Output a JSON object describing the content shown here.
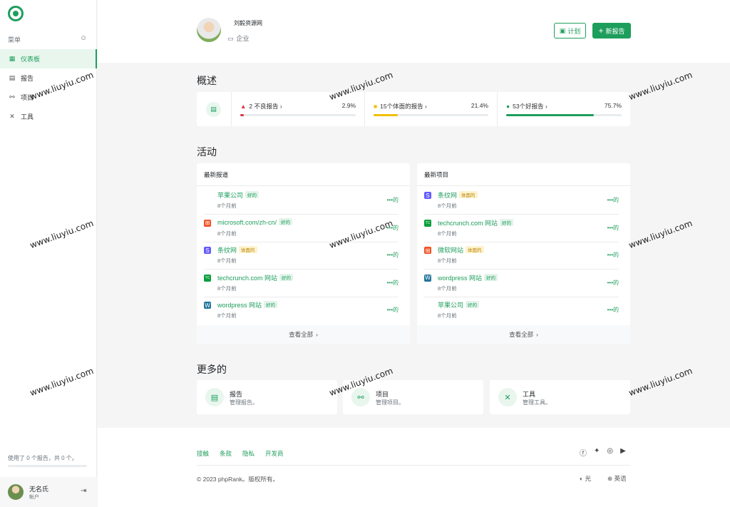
{
  "sidebar": {
    "menu_label": "菜单",
    "menu_toggle_icon": "☺",
    "items": [
      {
        "label": "仪表板",
        "icon": "grid-icon",
        "glyph": "▦",
        "active": true
      },
      {
        "label": "报告",
        "icon": "report-icon",
        "glyph": "▤",
        "active": false
      },
      {
        "label": "项目",
        "icon": "project-icon",
        "glyph": "⚯",
        "active": false
      },
      {
        "label": "工具",
        "icon": "tools-icon",
        "glyph": "✕",
        "active": false
      }
    ],
    "usage_text": "使用了 0 个报告，共 0 个。",
    "user": {
      "name": "无名氏",
      "role": "帐户",
      "logout_icon": "⇥"
    }
  },
  "header": {
    "org_name": "刘毅资源网",
    "org_type": "企业",
    "org_type_icon": "▭",
    "plan_label": "计划",
    "plan_icon": "▣",
    "new_report_label": "新报告",
    "new_icon": "+"
  },
  "overview": {
    "title": "概述",
    "icon": "▤",
    "items": [
      {
        "label": "2 不良报告",
        "percent": "2.9%",
        "value": 2.9,
        "color": "#dc3545",
        "marker": "▲",
        "chevron": "›"
      },
      {
        "label": "15个体面的报告",
        "percent": "21.4%",
        "value": 21.4,
        "color": "#f0c000",
        "marker": "■",
        "chevron": "›"
      },
      {
        "label": "53个好报告",
        "percent": "75.7%",
        "value": 75.7,
        "color": "#1e9e5c",
        "marker": "●",
        "chevron": "›"
      }
    ]
  },
  "activity": {
    "title": "活动",
    "latest_reports": {
      "title": "最新报道",
      "footer": "查看全部",
      "rows": [
        {
          "title": "苹果公司",
          "badge": "好的",
          "badge_type": "good",
          "time": "8个月前",
          "more": "•••的",
          "icon": "apple-icon",
          "glyph": "",
          "color": "#888"
        },
        {
          "title": "microsoft.com/zh-cn/",
          "badge": "好的",
          "badge_type": "good",
          "time": "8个月前",
          "more": "•••的",
          "icon": "microsoft-icon",
          "glyph": "⊞",
          "color": "#f25022"
        },
        {
          "title": "条纹网",
          "badge": "体面的",
          "badge_type": "mid",
          "time": "8个月前",
          "more": "•••的",
          "icon": "stripe-icon",
          "glyph": "S",
          "color": "#635bff"
        },
        {
          "title": "techcrunch.com 网站",
          "badge": "好的",
          "badge_type": "good",
          "time": "8个月前",
          "more": "•••的",
          "icon": "techcrunch-icon",
          "glyph": "TC",
          "color": "#0a9e3b"
        },
        {
          "title": "wordpress 网站",
          "badge": "好的",
          "badge_type": "good",
          "time": "8个月前",
          "more": "•••的",
          "icon": "wordpress-icon",
          "glyph": "W",
          "color": "#21759b"
        }
      ]
    },
    "latest_projects": {
      "title": "最新项目",
      "footer": "查看全部",
      "rows": [
        {
          "title": "条纹网",
          "badge": "体面的",
          "badge_type": "mid",
          "time": "8个月前",
          "more": "•••的",
          "icon": "stripe-icon",
          "glyph": "S",
          "color": "#635bff"
        },
        {
          "title": "techcrunch.com 网站",
          "badge": "好的",
          "badge_type": "good",
          "time": "8个月前",
          "more": "•••的",
          "icon": "techcrunch-icon",
          "glyph": "TC",
          "color": "#0a9e3b"
        },
        {
          "title": "微软网站",
          "badge": "体面的",
          "badge_type": "mid",
          "time": "8个月前",
          "more": "•••的",
          "icon": "microsoft-icon",
          "glyph": "⊞",
          "color": "#f25022"
        },
        {
          "title": "wordpress 网站",
          "badge": "好的",
          "badge_type": "good",
          "time": "8个月前",
          "more": "•••的",
          "icon": "wordpress-icon",
          "glyph": "W",
          "color": "#21759b"
        },
        {
          "title": "苹果公司",
          "badge": "好的",
          "badge_type": "good",
          "time": "8个月前",
          "more": "•••的",
          "icon": "apple-icon",
          "glyph": "",
          "color": "#888"
        }
      ]
    }
  },
  "more": {
    "title": "更多的",
    "cards": [
      {
        "title": "报告",
        "sub": "管理报告。",
        "icon": "report-icon",
        "glyph": "▤"
      },
      {
        "title": "项目",
        "sub": "管理项目。",
        "icon": "project-icon",
        "glyph": "⚯"
      },
      {
        "title": "工具",
        "sub": "管理工具。",
        "icon": "tools-icon",
        "glyph": "✕"
      }
    ]
  },
  "footer": {
    "links": [
      "接触",
      "条款",
      "隐私",
      "开发商"
    ],
    "social": [
      {
        "icon": "facebook-icon",
        "glyph": "ⓕ"
      },
      {
        "icon": "twitter-icon",
        "glyph": "🐦"
      },
      {
        "icon": "instagram-icon",
        "glyph": "◎"
      },
      {
        "icon": "youtube-icon",
        "glyph": "▶"
      }
    ],
    "copyright": "© 2023 phpRank。版权所有。",
    "theme_label": "光",
    "theme_icon": "◐",
    "language_label": "英语",
    "language_icon": "⊕"
  },
  "watermark": "www.liuyiu.com"
}
